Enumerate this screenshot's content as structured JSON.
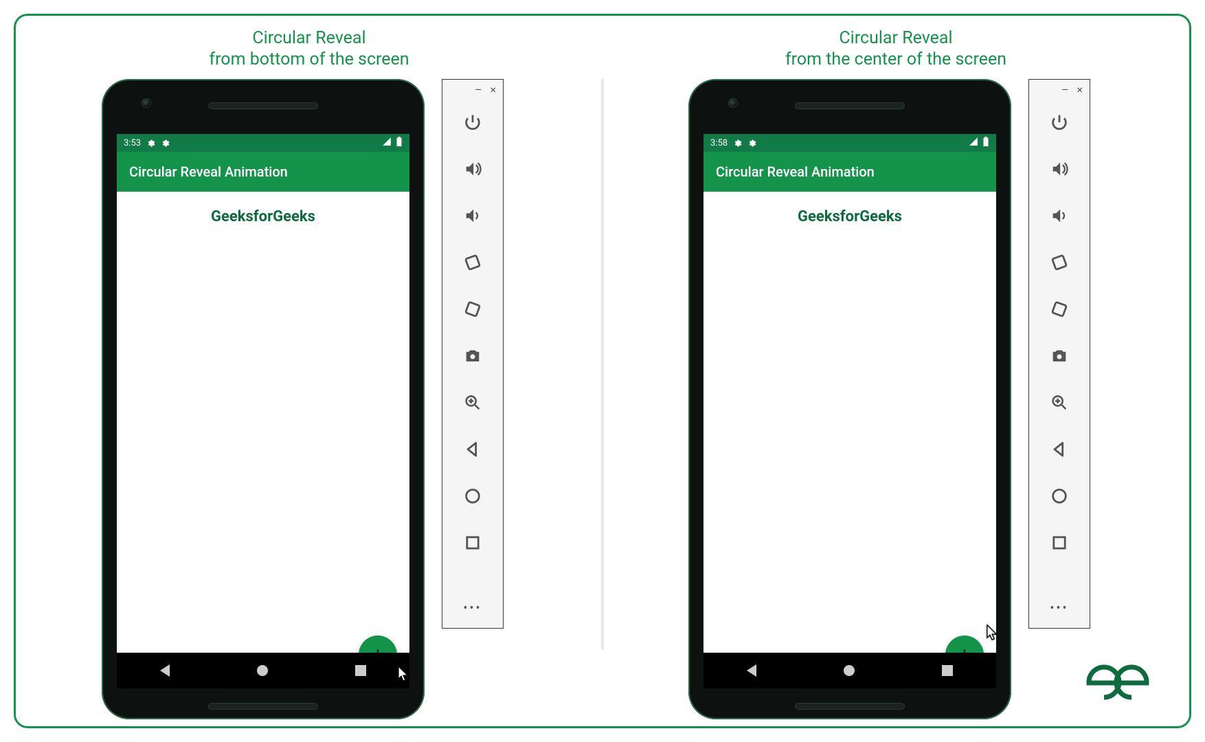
{
  "brand": {
    "accent": "#14934a",
    "text_accent": "#0e6b3f"
  },
  "captions": {
    "left_line1": "Circular Reveal",
    "left_line2": "from bottom of the screen",
    "right_line1": "Circular Reveal",
    "right_line2": "from the center of the screen"
  },
  "phone_left": {
    "status_time": "3:53",
    "app_bar_title": "Circular Reveal Animation",
    "body_title": "GeeksforGeeks",
    "fab_glyph": "+"
  },
  "phone_right": {
    "status_time": "3:58",
    "app_bar_title": "Circular Reveal Animation",
    "body_title": "GeeksforGeeks",
    "fab_glyph": "+"
  },
  "emulator_toolbar": {
    "minimize_glyph": "–",
    "close_glyph": "×",
    "more_glyph": "•••",
    "buttons": [
      "power",
      "volume-up",
      "volume-down",
      "rotate-left",
      "rotate-right",
      "screenshot",
      "zoom-in",
      "back",
      "home",
      "overview"
    ]
  },
  "logo_text": "GfG"
}
